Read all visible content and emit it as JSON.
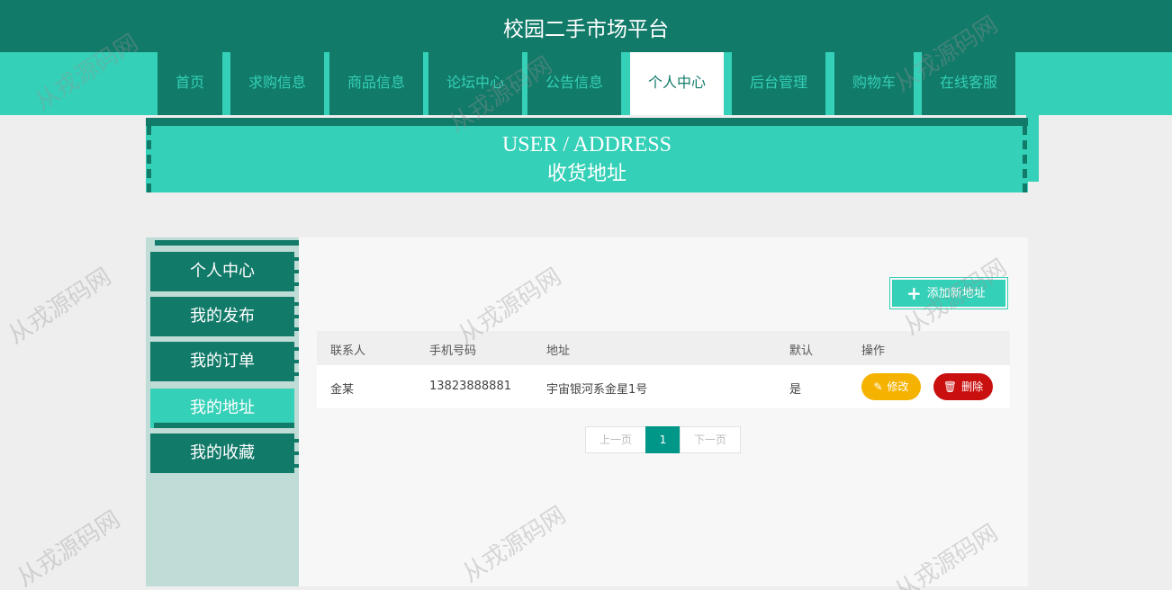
{
  "site_title": "校园二手市场平台",
  "nav": [
    {
      "label": "首页",
      "active": false
    },
    {
      "label": "求购信息",
      "active": false
    },
    {
      "label": "商品信息",
      "active": false
    },
    {
      "label": "论坛中心",
      "active": false
    },
    {
      "label": "公告信息",
      "active": false
    },
    {
      "label": "个人中心",
      "active": true
    },
    {
      "label": "后台管理",
      "active": false
    },
    {
      "label": "购物车",
      "active": false
    },
    {
      "label": "在线客服",
      "active": false
    }
  ],
  "banner": {
    "en": "USER / ADDRESS",
    "cn": "收货地址"
  },
  "sidebar": [
    {
      "label": "个人中心",
      "active": false
    },
    {
      "label": "我的发布",
      "active": false
    },
    {
      "label": "我的订单",
      "active": false
    },
    {
      "label": "我的地址",
      "active": true
    },
    {
      "label": "我的收藏",
      "active": false
    }
  ],
  "add_button": "添加新地址",
  "table": {
    "headers": [
      "联系人",
      "手机号码",
      "地址",
      "默认",
      "操作"
    ],
    "rows": [
      {
        "contact": "金某",
        "phone": "13823888881",
        "address": "宇宙银河系金星1号",
        "default": "是"
      }
    ],
    "edit_label": "修改",
    "delete_label": "删除"
  },
  "pagination": {
    "prev": "上一页",
    "current": "1",
    "next": "下一页"
  },
  "watermark": "从戎源码网",
  "colors": {
    "dark_teal": "#127a69",
    "teal": "#34d0b7",
    "edit": "#f5b300",
    "delete": "#c9100f",
    "page_active": "#009688"
  }
}
